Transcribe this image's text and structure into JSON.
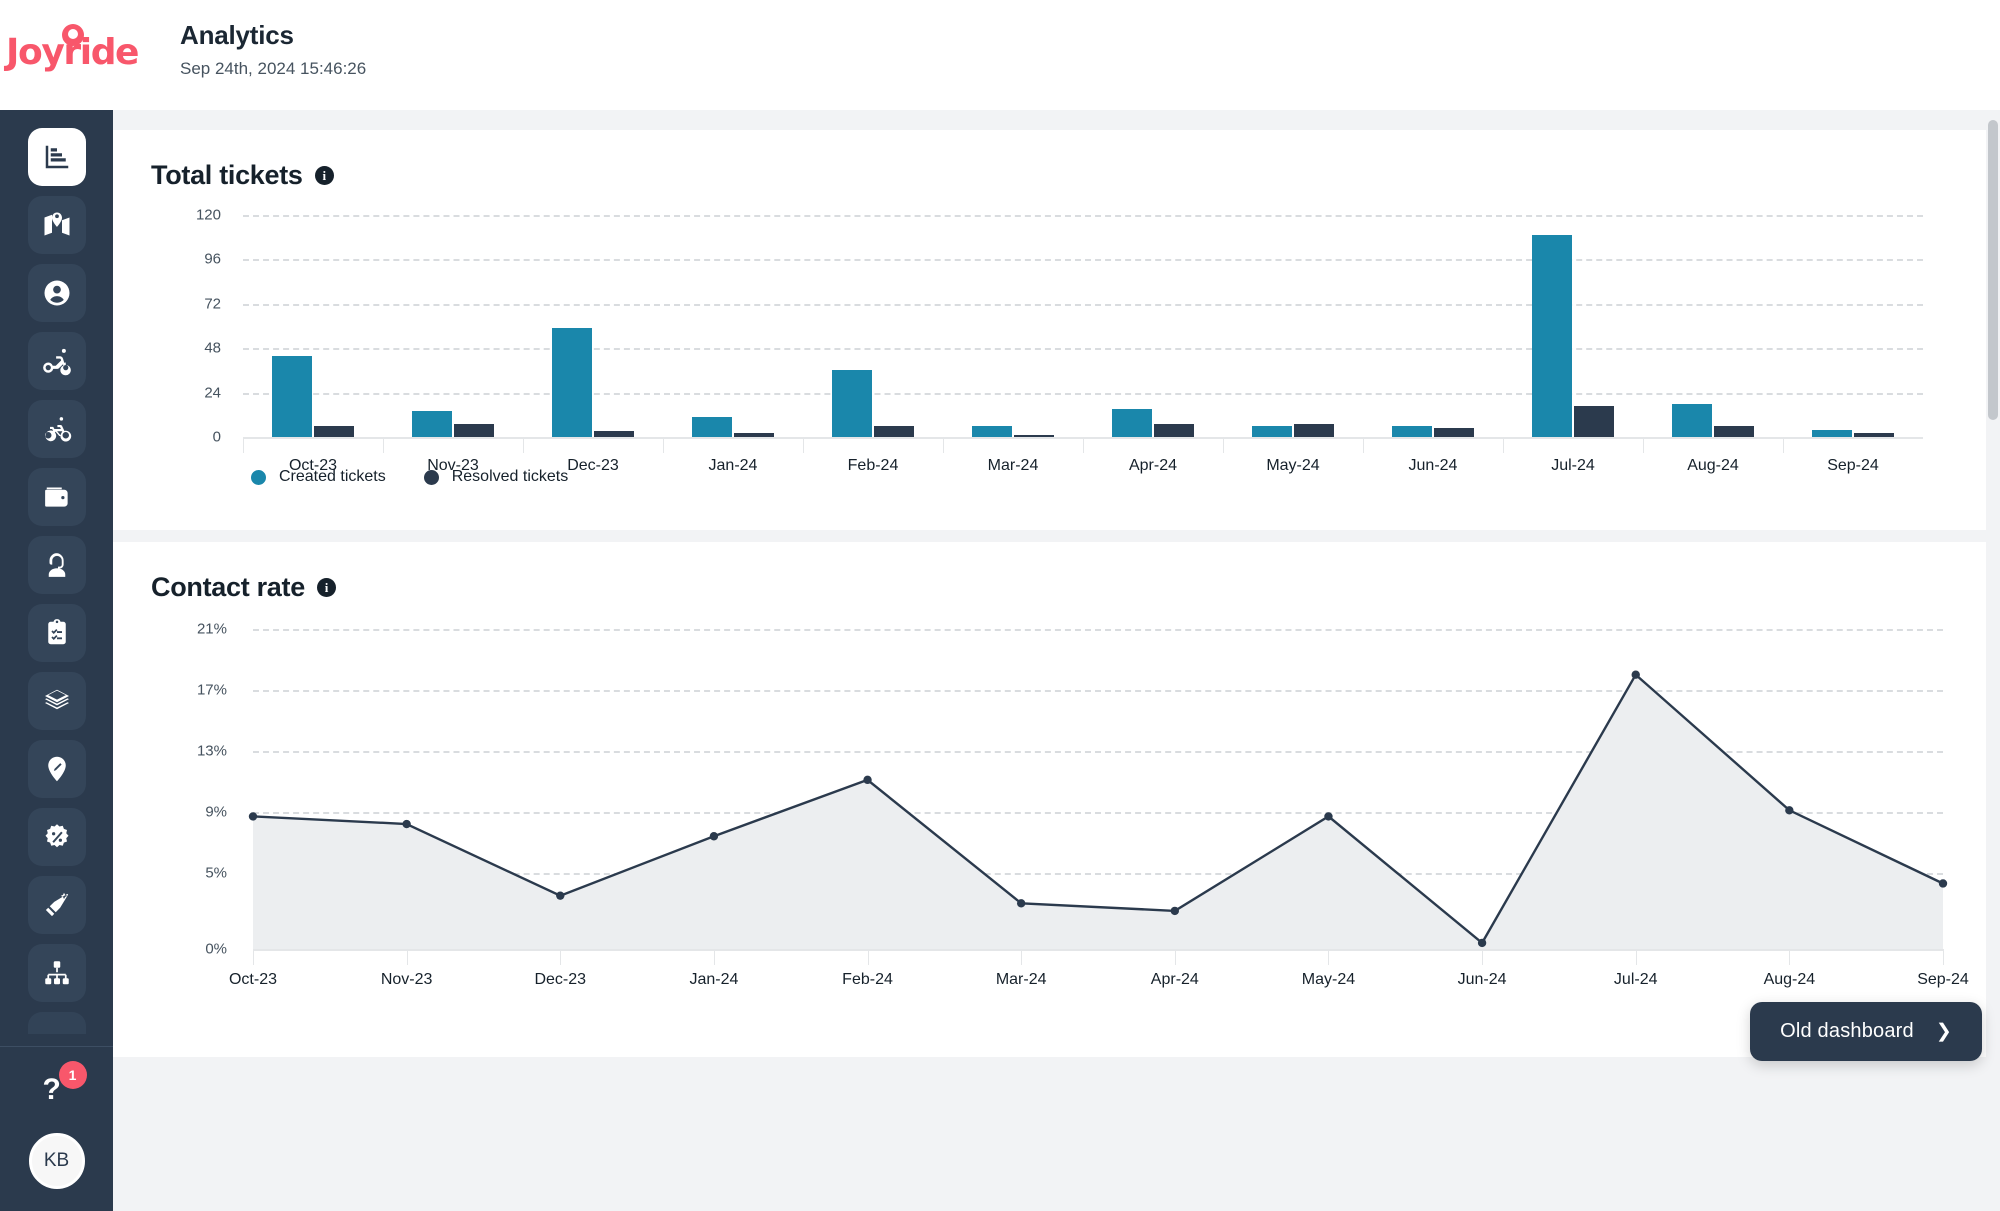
{
  "brand": {
    "name": "Joyride",
    "color": "#F8576B"
  },
  "header": {
    "title": "Analytics",
    "timestamp": "Sep 24th, 2024 15:46:26"
  },
  "sidebar": {
    "items": [
      {
        "icon": "analytics-bar-chart-icon",
        "label": "Analytics",
        "active": true
      },
      {
        "icon": "map-icon",
        "label": "Map",
        "active": false
      },
      {
        "icon": "user-circle-icon",
        "label": "Users",
        "active": false
      },
      {
        "icon": "scooter-icon",
        "label": "Scooters",
        "active": false
      },
      {
        "icon": "bicycle-icon",
        "label": "Bikes",
        "active": false
      },
      {
        "icon": "wallet-icon",
        "label": "Payments",
        "active": false
      },
      {
        "icon": "support-agent-icon",
        "label": "Support",
        "active": false
      },
      {
        "icon": "clipboard-checklist-icon",
        "label": "Tasks",
        "active": false
      },
      {
        "icon": "layers-icon",
        "label": "Fleets",
        "active": false
      },
      {
        "icon": "map-pin-edit-icon",
        "label": "Zones",
        "active": false
      },
      {
        "icon": "discount-badge-icon",
        "label": "Promotions",
        "active": false
      },
      {
        "icon": "megaphone-icon",
        "label": "Campaigns",
        "active": false
      },
      {
        "icon": "org-hierarchy-icon",
        "label": "Organization",
        "active": false
      }
    ],
    "help": {
      "icon": "help-question-icon",
      "badge": "1"
    },
    "avatar": {
      "initials": "KB"
    }
  },
  "cards": {
    "tickets": {
      "title": "Total tickets",
      "info_icon": "info-icon"
    },
    "contact": {
      "title": "Contact rate",
      "info_icon": "info-icon"
    }
  },
  "footer_button": {
    "label": "Old dashboard",
    "icon": "chevron-right-icon"
  },
  "chart_data": [
    {
      "id": "total-tickets",
      "type": "bar",
      "title": "Total tickets",
      "xlabel": "",
      "ylabel": "",
      "ylim": [
        0,
        120
      ],
      "yticks": [
        0,
        24,
        48,
        72,
        96,
        120
      ],
      "ytick_labels": [
        "0",
        "24",
        "48",
        "72",
        "96",
        "120"
      ],
      "grid": true,
      "legend_position": "bottom-left",
      "categories": [
        "Oct-23",
        "Nov-23",
        "Dec-23",
        "Jan-24",
        "Feb-24",
        "Mar-24",
        "Apr-24",
        "May-24",
        "Jun-24",
        "Jul-24",
        "Aug-24",
        "Sep-24"
      ],
      "series": [
        {
          "name": "Created tickets",
          "color": "#1a87ab",
          "values": [
            44,
            14,
            59,
            11,
            36,
            6,
            15,
            6,
            6,
            109,
            18,
            4
          ]
        },
        {
          "name": "Resolved tickets",
          "color": "#2b3a4d",
          "values": [
            6,
            7,
            3,
            2,
            6,
            1,
            7,
            7,
            5,
            17,
            6,
            2
          ]
        }
      ]
    },
    {
      "id": "contact-rate",
      "type": "area",
      "title": "Contact rate",
      "xlabel": "",
      "ylabel": "",
      "ylim": [
        0,
        21
      ],
      "yticks": [
        0,
        5,
        9,
        13,
        17,
        21
      ],
      "ytick_labels": [
        "0%",
        "5%",
        "9%",
        "13%",
        "17%",
        "21%"
      ],
      "grid": true,
      "legend_position": "none",
      "line_color": "#2b3a4d",
      "fill_color": "#eceef0",
      "categories": [
        "Oct-23",
        "Nov-23",
        "Dec-23",
        "Jan-24",
        "Feb-24",
        "Mar-24",
        "Apr-24",
        "May-24",
        "Jun-24",
        "Jul-24",
        "Aug-24",
        "Sep-24"
      ],
      "series": [
        {
          "name": "Contact rate",
          "values": [
            8.7,
            8.2,
            3.5,
            7.4,
            11.1,
            3.0,
            2.5,
            8.7,
            0.4,
            18.0,
            9.1,
            4.3
          ]
        }
      ]
    }
  ]
}
